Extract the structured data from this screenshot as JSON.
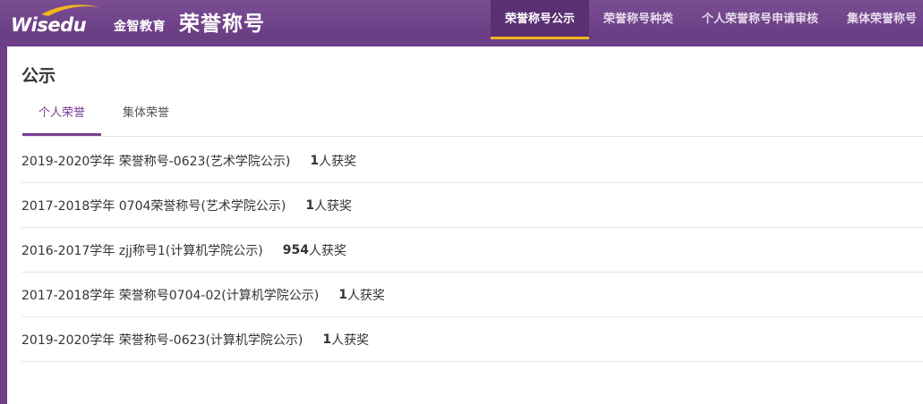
{
  "header": {
    "logo_text": "Wisedu",
    "brand_sub": "金智教育",
    "app_title": "荣誉称号",
    "accent_color": "#f2b61c",
    "nav": [
      {
        "label": "荣誉称号公示",
        "active": true
      },
      {
        "label": "荣誉称号种类",
        "active": false
      },
      {
        "label": "个人荣誉称号申请审核",
        "active": false
      },
      {
        "label": "集体荣誉称号",
        "active": false
      }
    ]
  },
  "main": {
    "title": "公示",
    "tabs": [
      {
        "label": "个人荣誉",
        "active": true
      },
      {
        "label": "集体荣誉",
        "active": false
      }
    ],
    "rows": [
      {
        "title": "2019-2020学年 荣誉称号-0623(艺术学院公示)",
        "count": "1",
        "suffix": "人获奖"
      },
      {
        "title": "2017-2018学年 0704荣誉称号(艺术学院公示)",
        "count": "1",
        "suffix": "人获奖"
      },
      {
        "title": "2016-2017学年 zjj称号1(计算机学院公示)",
        "count": "954",
        "suffix": "人获奖"
      },
      {
        "title": "2017-2018学年 荣誉称号0704-02(计算机学院公示)",
        "count": "1",
        "suffix": "人获奖"
      },
      {
        "title": "2019-2020学年 荣誉称号-0623(计算机学院公示)",
        "count": "1",
        "suffix": "人获奖"
      }
    ]
  }
}
